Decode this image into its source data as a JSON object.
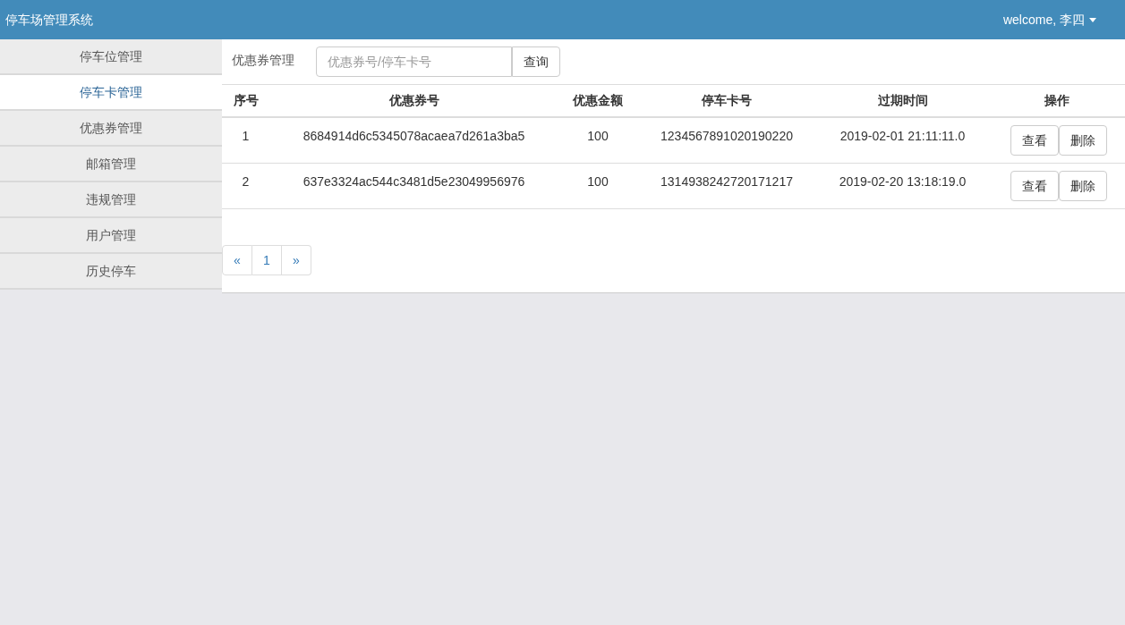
{
  "header": {
    "title": "停车场管理系统",
    "user_menu": "welcome, 李四"
  },
  "sidebar": {
    "items": [
      {
        "label": "停车位管理",
        "selected": false
      },
      {
        "label": "停车卡管理",
        "selected": true
      },
      {
        "label": "优惠券管理",
        "selected": false
      },
      {
        "label": "邮箱管理",
        "selected": false
      },
      {
        "label": "违规管理",
        "selected": false
      },
      {
        "label": "用户管理",
        "selected": false
      },
      {
        "label": "历史停车",
        "selected": false
      }
    ]
  },
  "toolbar": {
    "label": "优惠券管理",
    "search": {
      "placeholder": "优惠券号/停车卡号"
    },
    "button": "查询"
  },
  "table": {
    "columns": [
      "序号",
      "优惠券号",
      "优惠金额",
      "停车卡号",
      "过期时间",
      "操作"
    ],
    "rows": [
      {
        "cells": [
          "1",
          "8684914d6c5345078acaea7d261a3ba5",
          "100",
          "1234567891020190220",
          "2019-02-01 21:11:11.0"
        ],
        "actions": [
          "查看",
          "删除"
        ]
      },
      {
        "cells": [
          "2",
          "637e3324ac544c3481d5e23049956976",
          "100",
          "1314938242720171217",
          "2019-02-20 13:18:19.0"
        ],
        "actions": [
          "查看",
          "删除"
        ]
      }
    ]
  },
  "pagination": {
    "prev": "«",
    "pages": [
      {
        "label": "1",
        "selected": false
      }
    ],
    "next": "»"
  }
}
